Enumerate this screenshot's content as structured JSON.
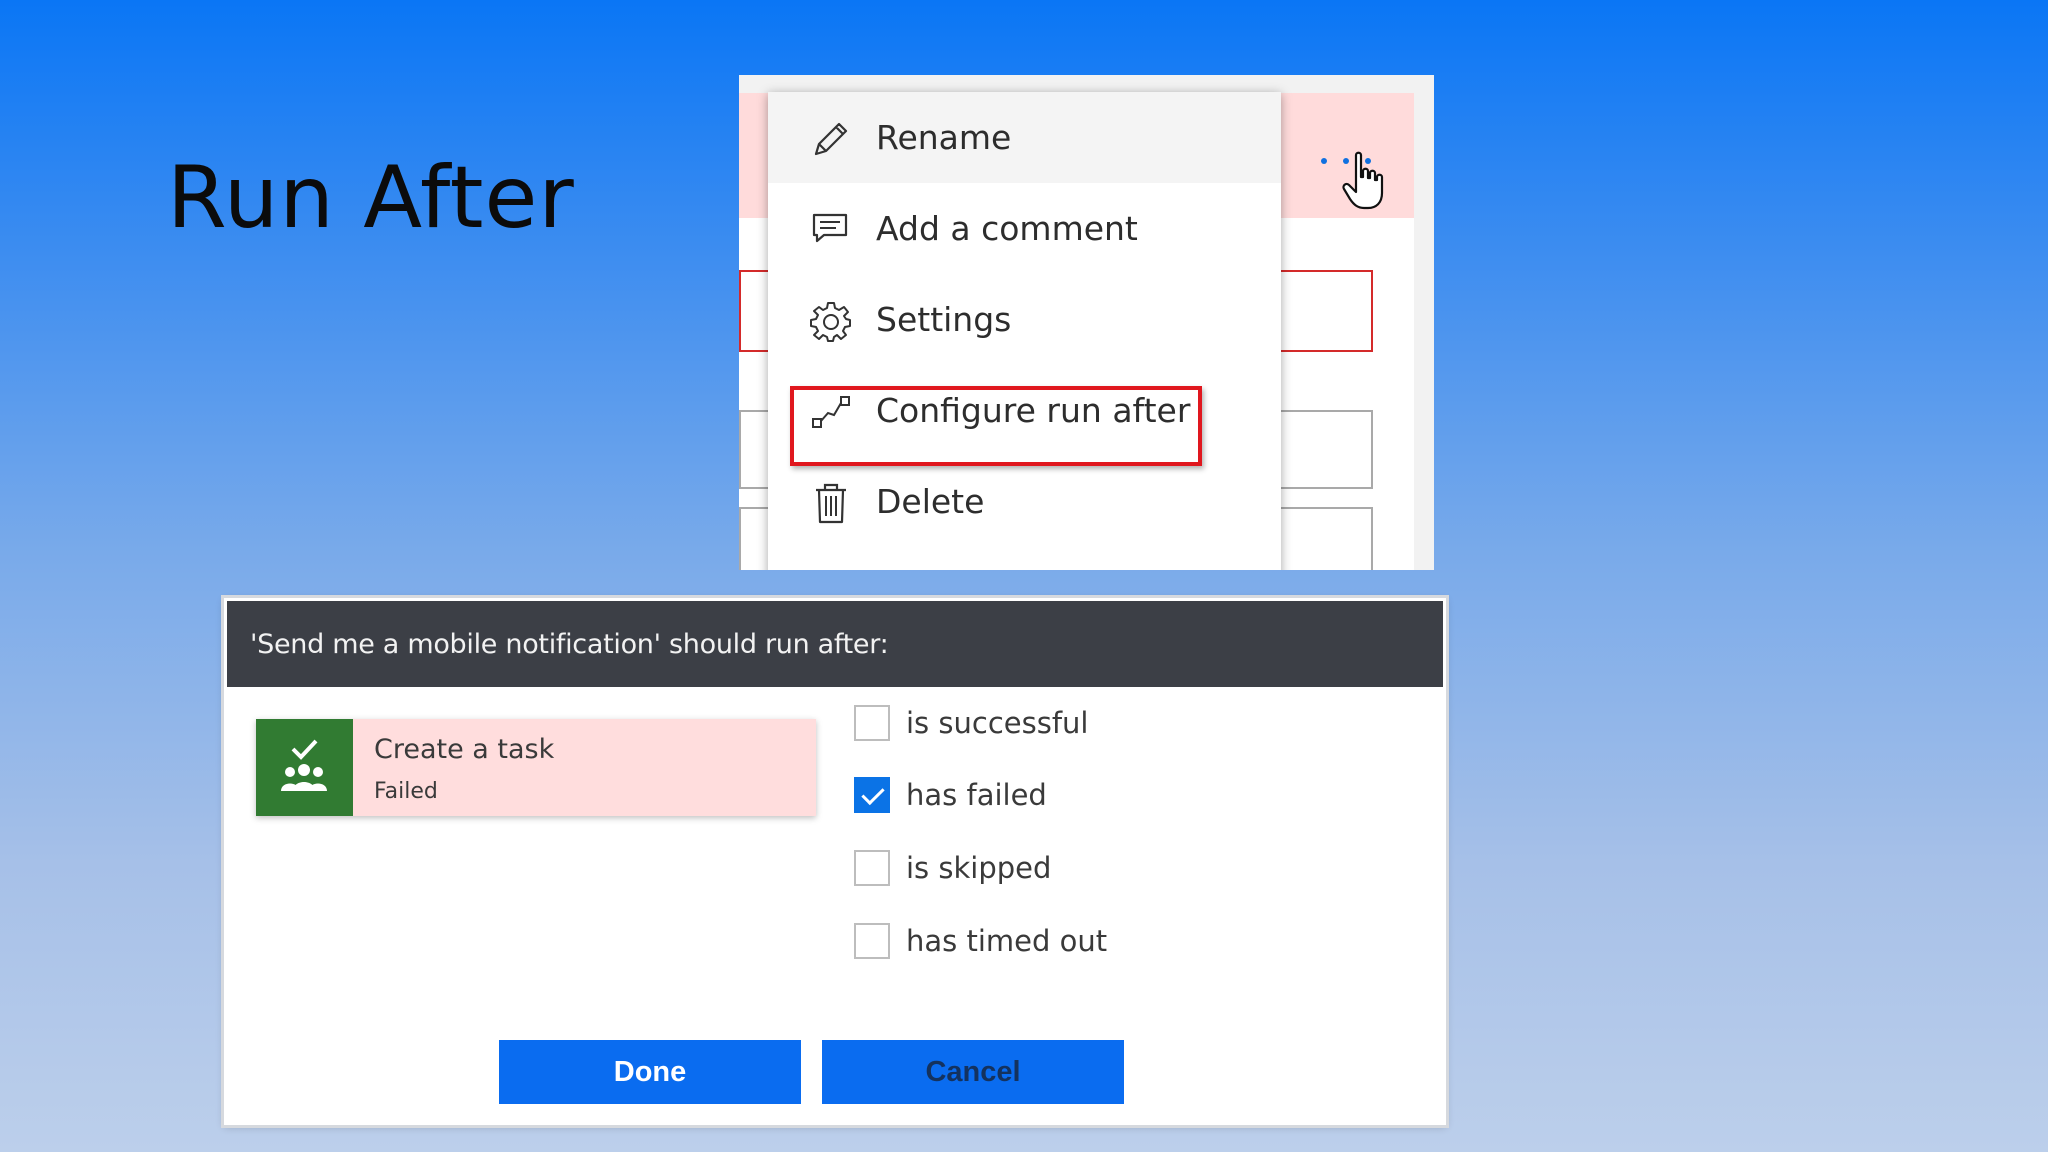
{
  "slide": {
    "title": "Run After"
  },
  "context_menu": {
    "items": [
      {
        "label": "Rename",
        "icon": "pencil-icon"
      },
      {
        "label": "Add a comment",
        "icon": "comment-icon"
      },
      {
        "label": "Settings",
        "icon": "gear-icon"
      },
      {
        "label": "Configure run after",
        "icon": "run-after-icon"
      },
      {
        "label": "Delete",
        "icon": "trash-icon"
      }
    ],
    "highlighted_item": "Configure run after",
    "highlight_color": "#e0171e"
  },
  "dialog": {
    "title": "'Send me a mobile notification' should run after:",
    "task": {
      "name": "Create a task",
      "status": "Failed",
      "icon": "task-check-people-icon",
      "icon_color": "#317b32"
    },
    "options": [
      {
        "label": "is successful",
        "checked": false
      },
      {
        "label": "has failed",
        "checked": true
      },
      {
        "label": "is skipped",
        "checked": false
      },
      {
        "label": "has timed out",
        "checked": false
      }
    ],
    "buttons": {
      "done": "Done",
      "cancel": "Cancel"
    },
    "accent_color": "#0a6cf0"
  }
}
